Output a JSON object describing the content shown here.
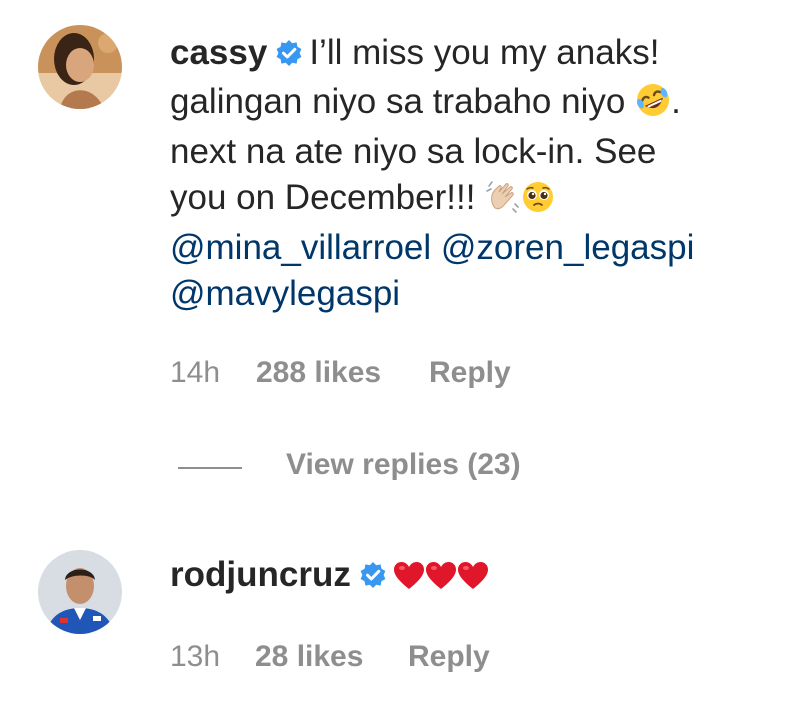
{
  "comments": [
    {
      "username": "cassy",
      "verified": true,
      "text_lines": [
        "I’ll miss you my anaks!",
        "galingan niyo sa trabaho niyo",
        ".",
        "next na ate niyo sa lock-in. See",
        "you on December!!!"
      ],
      "mentions": [
        "@mina_villarroel",
        "@zoren_legaspi",
        "@mavylegaspi"
      ],
      "emojis": [
        "rolling-on-floor-laughing-emoji",
        "waving-hand-emoji",
        "pleading-face-emoji"
      ],
      "time": "14h",
      "likes": "288 likes",
      "reply_label": "Reply",
      "view_replies": "View replies (23)"
    },
    {
      "username": "rodjuncruz",
      "verified": true,
      "emojis": [
        "red-heart-emoji",
        "red-heart-emoji",
        "red-heart-emoji"
      ],
      "time": "13h",
      "likes": "28 likes",
      "reply_label": "Reply"
    }
  ],
  "colors": {
    "text": "#262626",
    "secondary": "#8e8e8e",
    "mention": "#00376b",
    "verified": "#3897f0",
    "heart": "#e0162b"
  }
}
